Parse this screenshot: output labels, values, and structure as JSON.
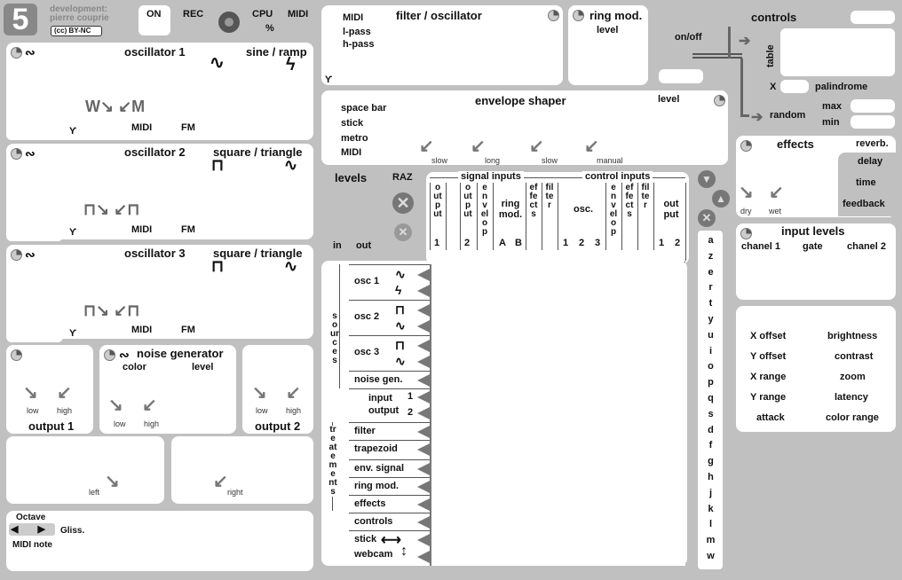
{
  "header": {
    "logo": "5",
    "dev_label": "development:",
    "dev_name": "pierre couprie",
    "license": "BY-NC",
    "on": "ON",
    "rec": "REC",
    "cpu": "CPU",
    "cpu_unit": "%",
    "midi": "MIDI"
  },
  "filter": {
    "title": "filter / oscillator",
    "midi": "MIDI",
    "lpass": "l-pass",
    "hpass": "h-pass"
  },
  "ringmod": {
    "title": "ring mod.",
    "level": "level"
  },
  "controls": {
    "title": "controls",
    "onoff": "on/off",
    "table": "table",
    "x": "X",
    "palindrome": "palindrome",
    "random": "random",
    "max": "max",
    "min": "min"
  },
  "osc1": {
    "title": "oscillator 1",
    "wave": "sine / ramp",
    "midi": "MIDI",
    "fm": "FM"
  },
  "osc2": {
    "title": "oscillator 2",
    "wave": "square / triangle",
    "midi": "MIDI",
    "fm": "FM"
  },
  "osc3": {
    "title": "oscillator 3",
    "wave": "square / triangle",
    "midi": "MIDI",
    "fm": "FM"
  },
  "envelope": {
    "title": "envelope shaper",
    "level": "level",
    "triggers": [
      "space bar",
      "stick",
      "metro",
      "MIDI"
    ],
    "knobs": [
      "slow",
      "long",
      "slow",
      "manual"
    ]
  },
  "effects": {
    "title": "effects",
    "reverb": "reverb.",
    "delay": "delay",
    "time": "time",
    "feedback": "feedback",
    "dry": "dry",
    "wet": "wet"
  },
  "levels": {
    "title": "levels",
    "raz": "RAZ",
    "in": "in",
    "out": "out"
  },
  "matrix": {
    "signal_inputs": "signal inputs",
    "control_inputs": "control inputs",
    "cols": {
      "output1": "output",
      "n1": "1",
      "output2": "output",
      "n2": "2",
      "envelop": "envelop",
      "ringmod": "ring mod.",
      "a": "A",
      "b": "B",
      "effects": "effects",
      "filter": "filter",
      "osc": "osc.",
      "o1": "1",
      "o2": "2",
      "o3": "3",
      "envelop2": "envelop",
      "effects2": "effects",
      "filter2": "filter",
      "outputc": "out put",
      "c1": "1",
      "c2": "2"
    },
    "sources_label": "sources",
    "treatments_label": "treatements",
    "rows": [
      "osc 1",
      "osc 2",
      "osc 3",
      "noise gen.",
      "input",
      "output",
      "filter",
      "trapezoid",
      "env. signal",
      "ring mod.",
      "effects",
      "controls",
      "stick",
      "webcam"
    ],
    "input_nums": [
      "1",
      "2"
    ]
  },
  "noise": {
    "title": "noise generator",
    "color": "color",
    "level": "level",
    "low": "low",
    "high": "high"
  },
  "output1": {
    "title": "output 1",
    "low": "low",
    "high": "high"
  },
  "output2": {
    "title": "output 2",
    "low": "low",
    "high": "high"
  },
  "pan": {
    "left": "left",
    "right": "right"
  },
  "keyboard": {
    "octave": "Octave",
    "gliss": "Gliss.",
    "midi_note": "MIDI note",
    "letters": [
      "a",
      "z",
      "e",
      "r",
      "t",
      "y",
      "u",
      "i",
      "o",
      "p",
      "q",
      "s",
      "d",
      "f",
      "g",
      "h",
      "j",
      "k",
      "l",
      "m",
      "w"
    ]
  },
  "input_levels": {
    "title": "input levels",
    "ch1": "chanel 1",
    "gate": "gate",
    "ch2": "chanel 2"
  },
  "video": {
    "items": [
      [
        "X offset",
        "brightness"
      ],
      [
        "Y offset",
        "contrast"
      ],
      [
        "X range",
        "zoom"
      ],
      [
        "Y range",
        "latency"
      ],
      [
        "attack",
        "color range"
      ]
    ]
  }
}
